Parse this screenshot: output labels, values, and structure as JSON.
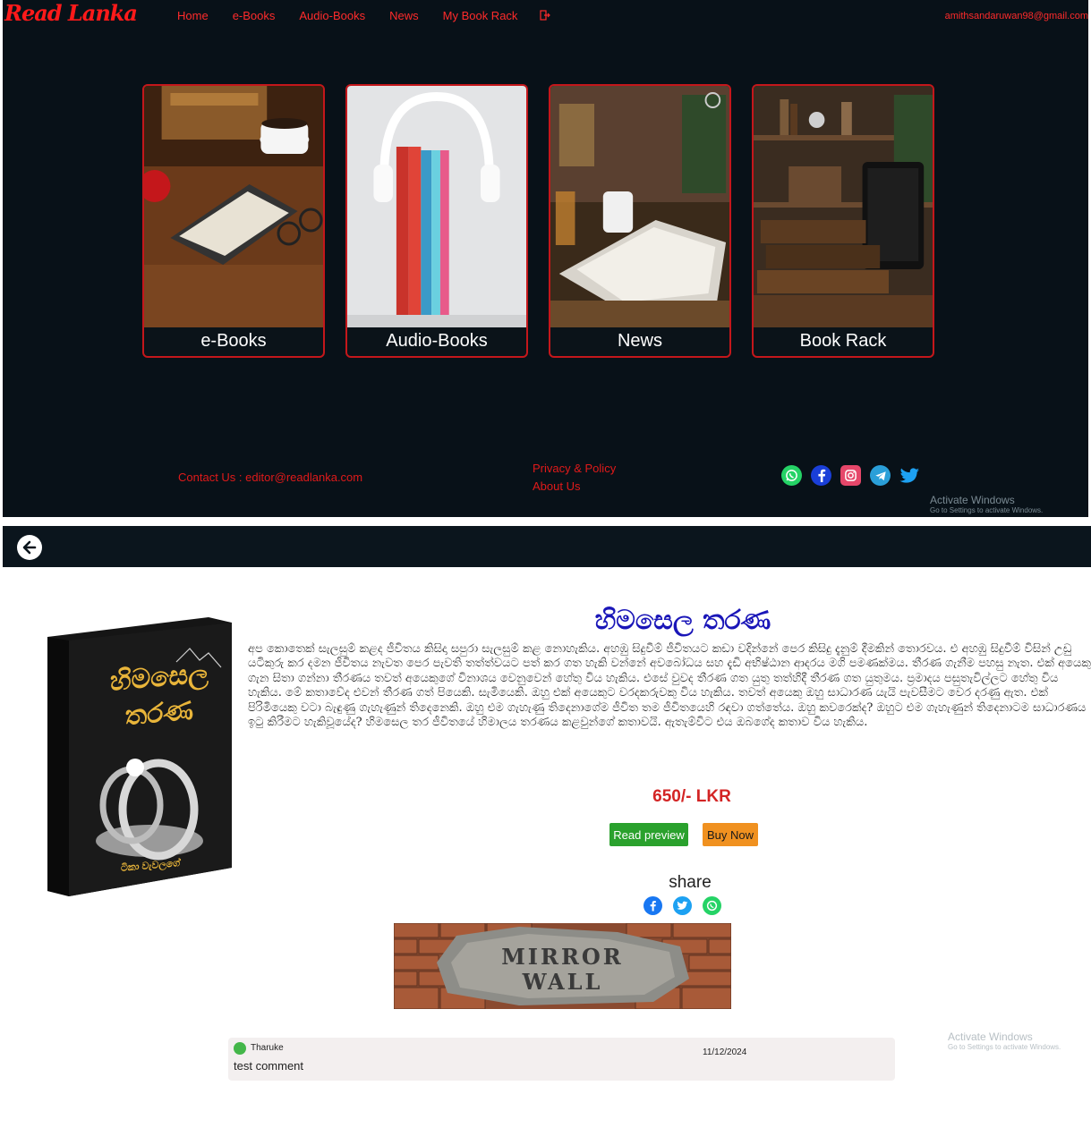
{
  "nav": {
    "logo": "Read Lanka",
    "links": [
      "Home",
      "e-Books",
      "Audio-Books",
      "News",
      "My Book Rack"
    ],
    "email": "amithsandaruwan98@gmail.com"
  },
  "cards": [
    {
      "label": "e-Books"
    },
    {
      "label": "Audio-Books"
    },
    {
      "label": "News"
    },
    {
      "label": "Book Rack"
    }
  ],
  "footer": {
    "contact": "Contact Us : editor@readlanka.com",
    "privacy": "Privacy & Policy",
    "about": "About Us",
    "socials": [
      "whatsapp-icon",
      "facebook-icon",
      "instagram-icon",
      "telegram-icon",
      "twitter-icon"
    ]
  },
  "watermark": {
    "title": "Activate Windows",
    "sub": "Go to Settings to activate Windows."
  },
  "book": {
    "cover_title_line1": "හිමසෙල",
    "cover_title_line2": "තරණ",
    "cover_author": "ටිකා වැවලගේ",
    "title": "හිමසෙල තරණ",
    "description": "අප කොතෙක් සැලසුම් කළද ජීවිතය කිසිදා සපුරා සැලසුම් කළ නොහැකිය. අහඹු සිදුවීම් ජීවිතයට කඩා වදින්නේ පෙර කිසිදු දැනුම් දීමකින් තොරවය. එ අහඹු සිදුවීම් විසින් උඩු යටිකුරු කර දමන ජීවිතය නැවත පෙර පැවති තත්ත්වයට පත් කර ගත හැකි වන්නේ අවබෝධය සහ දැඩි අභිෂ්ඨාන ආදරය මගි පමණක්මය. තීරණ ගැනීම පහසු නැත. එක් අයෙකු ගැන සිතා ගන්නා තීරණය තවත් අයෙකුගේ විනාශය වෙනුවෙන් හේතු විය හැකිය. එසේ වුවද තීරණ ගත යුතු තත්හිදී තීරණ ගත යුතුමය. ප්‍රමාදය පසුතැවිල්ලට හේතු විය හැකිය. මේ කතාවේද එවන් තීරණ ගත් පියෙකි. සැමියෙකි. ඔහු එක් අයෙකුට වරදකරුවකු විය හැකිය. තවත් අයෙකු ඔහු සාධාරණ යැයි පැවසීමට වෙර දරණු ඇත. එක් පිරිමියෙකු වටා බැඳුණු ගැහැණුන් තිදෙනෙකි. ඔහු එම ගැහැණු තිදෙනාගේම ජීවිත තම ජීවිතයෙහි රඳවා ගත්තේය. ඔහු කවරෙක්ද? ඔහුට එම ගැහැණුන් තිදෙනාටම සාධාරණය ඉටු කිරීමට හැකිවූයේද? හිමසෙල තර ජීවිතයේ හිමාලය තරණය කළවුන්ගේ කතාවයි. ඇතැම්විට එය ඔබගේද කතාව විය හැකිය.",
    "price": "650/- LKR",
    "read_preview": "Read preview",
    "buy_now": "Buy Now",
    "share": "share",
    "banner_line1": "MIRROR",
    "banner_line2": "WALL"
  },
  "comment": {
    "user": "Tharuke",
    "date": "11/12/2024",
    "text": "test comment"
  }
}
